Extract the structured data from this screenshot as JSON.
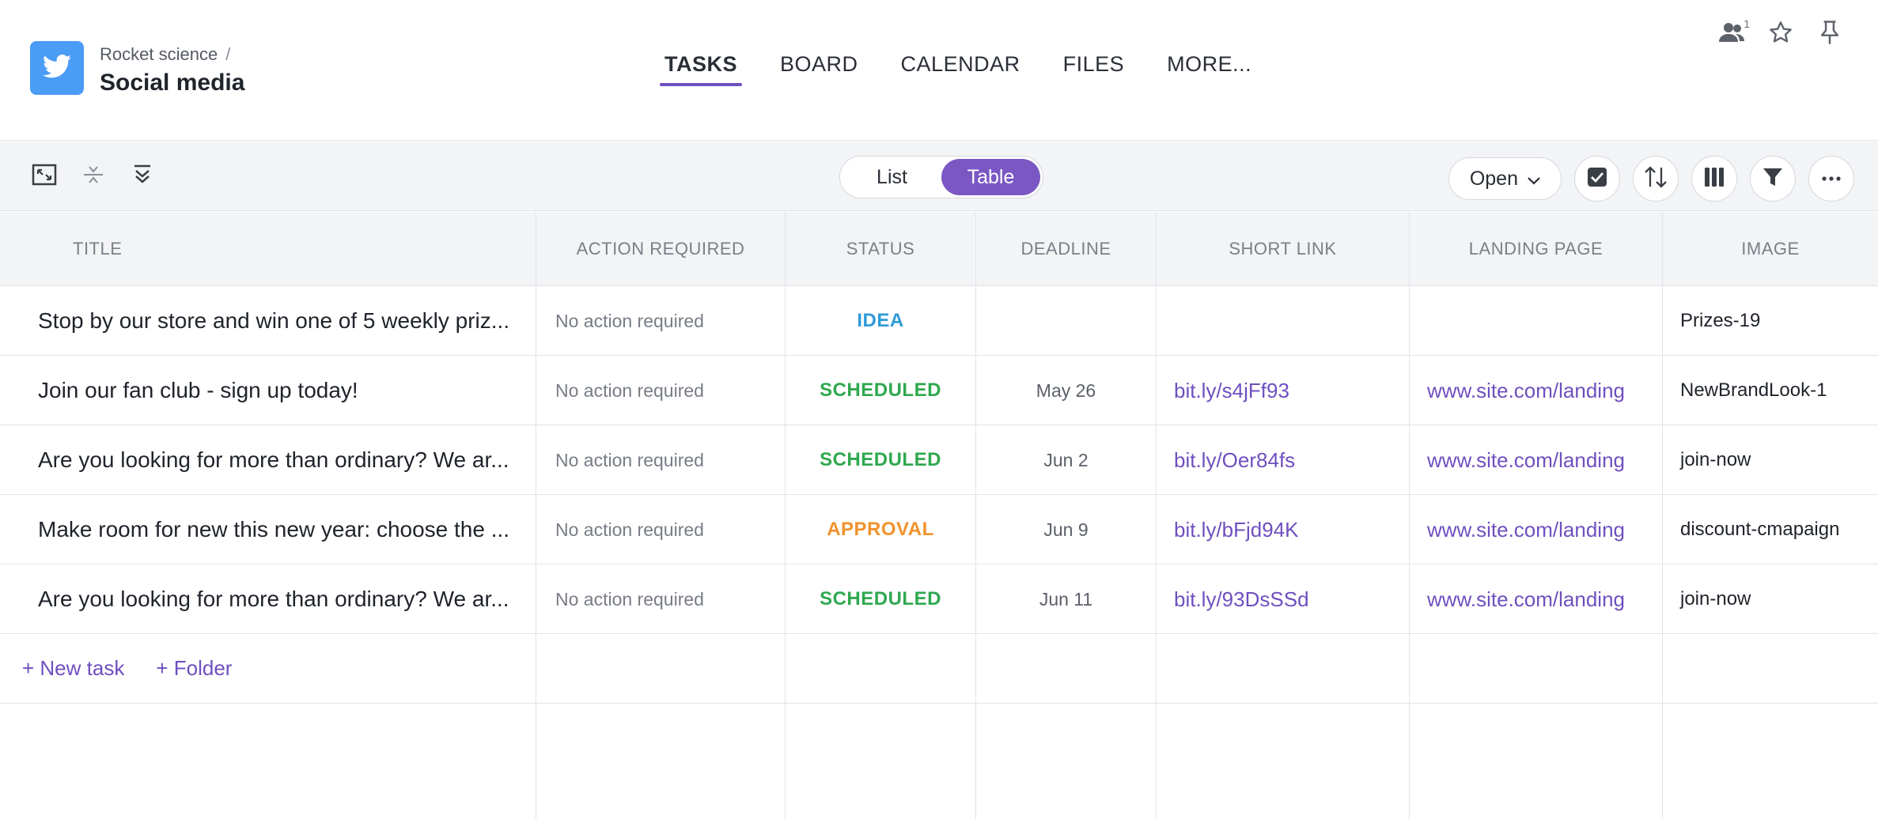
{
  "project": {
    "logo_icon": "twitter-bird-icon",
    "logo_color": "#4a9cf5",
    "breadcrumb_parent": "Rocket science",
    "breadcrumb_sep": "/",
    "title": "Social media"
  },
  "nav": {
    "tabs": [
      {
        "label": "TASKS",
        "active": true
      },
      {
        "label": "BOARD",
        "active": false
      },
      {
        "label": "CALENDAR",
        "active": false
      },
      {
        "label": "FILES",
        "active": false
      },
      {
        "label": "MORE...",
        "active": false
      }
    ]
  },
  "header_icons": {
    "members_count": "1",
    "members_icon": "members-icon",
    "star_icon": "star-icon",
    "pin_icon": "pin-icon"
  },
  "toolbar": {
    "view_toggle": {
      "list": "List",
      "table": "Table",
      "selected": "Table"
    },
    "status_filter": "Open",
    "accent": "#7b57c4"
  },
  "table": {
    "columns": [
      "TITLE",
      "ACTION REQUIRED",
      "STATUS",
      "DEADLINE",
      "SHORT LINK",
      "LANDING PAGE",
      "IMAGE"
    ],
    "rows": [
      {
        "title": "Stop by our store and win one of 5 weekly priz...",
        "action": "No action required",
        "status": "IDEA",
        "status_color": "#2f9bd8",
        "deadline": "",
        "short_link": "",
        "landing_page": "",
        "image": "Prizes-19"
      },
      {
        "title": "Join our fan club - sign up today!",
        "action": "No action required",
        "status": "SCHEDULED",
        "status_color": "#2fa84f",
        "deadline": "May 26",
        "short_link": "bit.ly/s4jFf93",
        "landing_page": "www.site.com/landing",
        "image": "NewBrandLook-1"
      },
      {
        "title": "Are you looking for more than ordinary? We ar...",
        "action": "No action required",
        "status": "SCHEDULED",
        "status_color": "#2fa84f",
        "deadline": "Jun 2",
        "short_link": "bit.ly/Oer84fs",
        "landing_page": "www.site.com/landing",
        "image": "join-now"
      },
      {
        "title": "Make room for new this new year: choose the ...",
        "action": "No action required",
        "status": "APPROVAL",
        "status_color": "#f0922b",
        "deadline": "Jun 9",
        "short_link": "bit.ly/bFjd94K",
        "landing_page": "www.site.com/landing",
        "image": "discount-cmapaign"
      },
      {
        "title": "Are you looking for more than ordinary? We ar...",
        "action": "No action required",
        "status": "SCHEDULED",
        "status_color": "#2fa84f",
        "deadline": "Jun 11",
        "short_link": "bit.ly/93DsSSd",
        "landing_page": "www.site.com/landing",
        "image": "join-now"
      }
    ],
    "add_task_label": "+ New task",
    "add_folder_label": "+ Folder"
  }
}
